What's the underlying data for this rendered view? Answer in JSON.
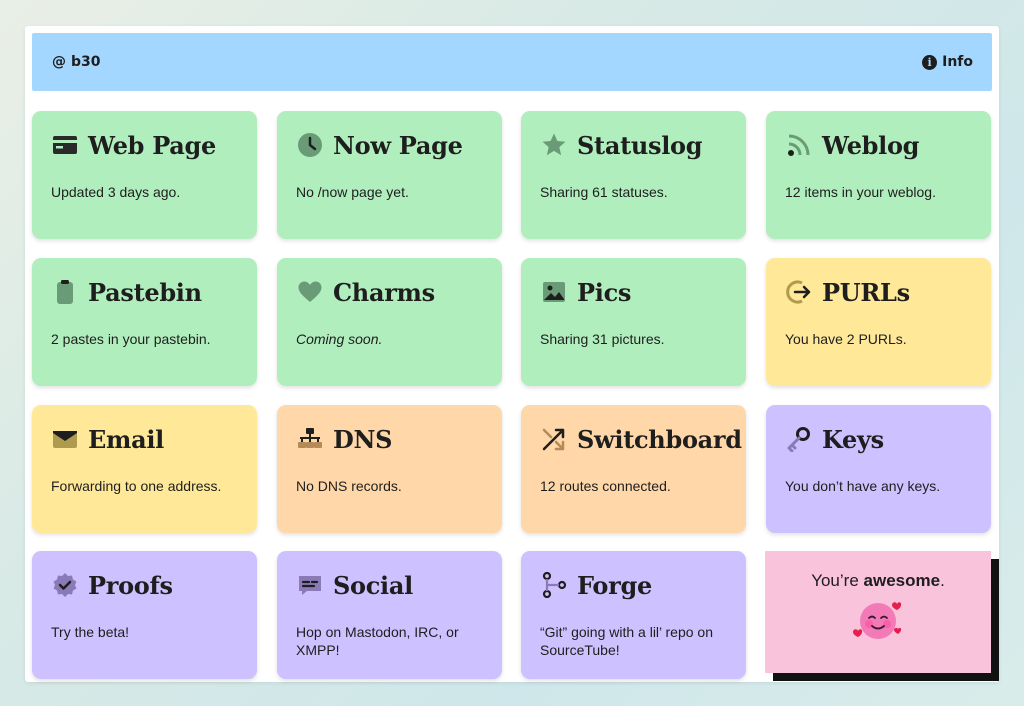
{
  "header": {
    "at": "@",
    "handle": "b30",
    "info_label": "Info",
    "info_icon": "info-circle-icon"
  },
  "colors": {
    "green": "#b1eebe",
    "yellow": "#ffe998",
    "orange": "#ffd7a8",
    "purple": "#cec1ff",
    "pink": "#f8c3db",
    "topbar": "#a3d7ff"
  },
  "tiles": [
    {
      "title": "Web Page",
      "desc": "Updated 3 days ago.",
      "icon": "browser-window-icon"
    },
    {
      "title": "Now Page",
      "desc": "No /now page yet.",
      "icon": "clock-icon"
    },
    {
      "title": "Statuslog",
      "desc": "Sharing 61 statuses.",
      "icon": "star-icon"
    },
    {
      "title": "Weblog",
      "desc": "12 items in your weblog.",
      "icon": "rss-icon"
    },
    {
      "title": "Pastebin",
      "desc": "2 pastes in your pastebin.",
      "icon": "clipboard-icon"
    },
    {
      "title": "Charms",
      "desc": "Coming soon.",
      "icon": "heart-icon"
    },
    {
      "title": "Pics",
      "desc": "Sharing 31 pictures.",
      "icon": "image-icon"
    },
    {
      "title": "PURLs",
      "desc": "You have 2 PURLs.",
      "icon": "redirect-arrow-icon"
    },
    {
      "title": "Email",
      "desc": "Forwarding to one address.",
      "icon": "envelope-icon"
    },
    {
      "title": "DNS",
      "desc": "No DNS records.",
      "icon": "network-icon"
    },
    {
      "title": "Switchboard",
      "desc": "12 routes connected.",
      "icon": "shuffle-icon"
    },
    {
      "title": "Keys",
      "desc": "You don’t have any keys.",
      "icon": "key-icon"
    },
    {
      "title": "Proofs",
      "desc": "Try the beta!",
      "icon": "verified-badge-icon"
    },
    {
      "title": "Social",
      "desc": "Hop on Mastodon, IRC, or XMPP!",
      "icon": "chat-bubble-icon"
    },
    {
      "title": "Forge",
      "desc": "“Git” going with a lil’ repo on SourceTube!",
      "icon": "git-branch-icon"
    }
  ],
  "awesome": {
    "prefix": "You’re ",
    "bold": "awesome",
    "suffix": ".",
    "icon": "smiling-face-with-hearts-icon"
  }
}
